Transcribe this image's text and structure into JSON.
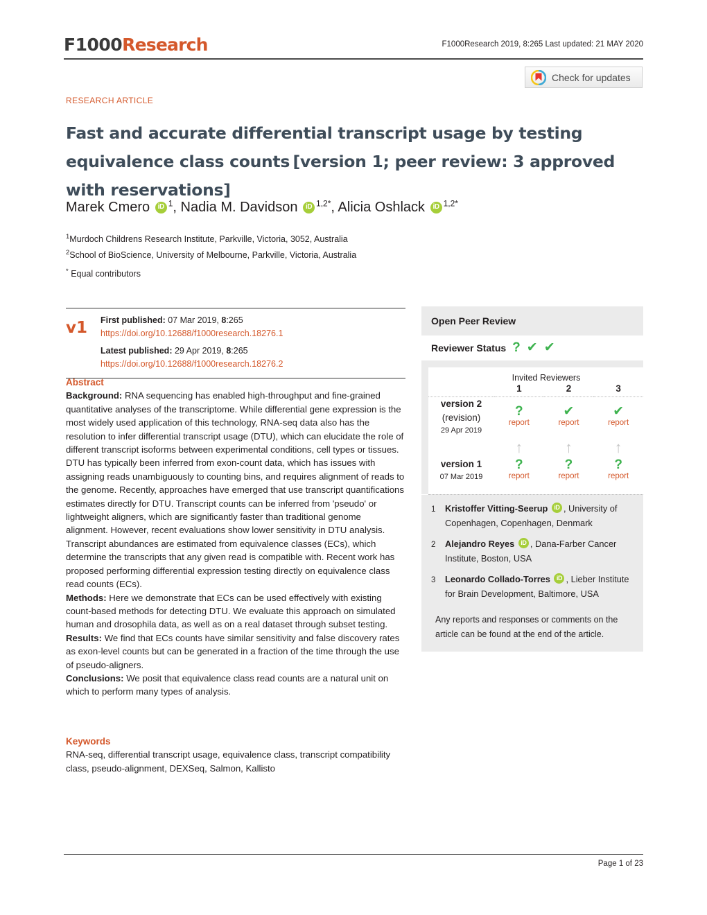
{
  "header": {
    "logo_f1000": "F1000",
    "logo_research": "Research",
    "running_head": "F1000Research 2019, 8:265 Last updated: 21 MAY 2020",
    "crossmark_label": "Check for updates",
    "crossmark_icon": "crossmark-icon"
  },
  "article": {
    "type": "RESEARCH ARTICLE",
    "title_main": "Fast and accurate differential transcript usage by testing equivalence class counts",
    "title_bracket": "[version 1; peer review: 3 approved with reservations]",
    "authors": [
      {
        "name": "Marek Cmero",
        "orcid": true,
        "sup": "1",
        "sep": ", "
      },
      {
        "name": "Nadia M. Davidson",
        "orcid": true,
        "sup": "1,2*",
        "sep": ", "
      },
      {
        "name": "Alicia Oshlack",
        "orcid": true,
        "sup": "1,2*",
        "sep": ""
      }
    ],
    "affiliations": [
      {
        "sup": "1",
        "text": "Murdoch Childrens Research Institute, Parkville, Victoria, 3052, Australia"
      },
      {
        "sup": "2",
        "text": "School of BioScience, University of Melbourne, Parkville, Victoria, Australia"
      }
    ],
    "equal_contrib_sup": "*",
    "equal_contrib": "Equal contributors"
  },
  "version_box": {
    "badge": "v1",
    "first_published_label": "First published:",
    "first_published_value": "07 Mar 2019, ",
    "first_published_vol": "8",
    "first_published_page": ":265",
    "first_doi": "https://doi.org/10.12688/f1000research.18276.1",
    "latest_published_label": "Latest published:",
    "latest_published_value": "29 Apr 2019, ",
    "latest_published_vol": "8",
    "latest_published_page": ":265",
    "latest_doi": "https://doi.org/10.12688/f1000research.18276.2"
  },
  "abstract": {
    "heading": "Abstract",
    "background_label": "Background:",
    "background_text": " RNA sequencing has enabled high-throughput and fine-grained quantitative analyses of the transcriptome. While differential gene expression is the most widely used application of this technology, RNA-seq data also has the resolution to infer differential transcript usage (DTU), which can elucidate the role of different transcript isoforms between experimental conditions, cell types or tissues. DTU has typically been inferred from exon-count data, which has issues with assigning reads unambiguously to counting bins, and requires alignment of reads to the genome. Recently, approaches have emerged that use transcript quantifications estimates directly for DTU. Transcript counts can be inferred from 'pseudo' or lightweight aligners, which are significantly faster than traditional genome alignment. However, recent evaluations show lower sensitivity in DTU analysis. Transcript abundances are estimated from equivalence classes (ECs), which determine the transcripts that any given read is compatible with. Recent work has proposed performing differential expression testing directly on equivalence class read counts (ECs).",
    "methods_label": "Methods:",
    "methods_text": " Here we demonstrate that ECs can be used effectively with existing count-based methods for detecting DTU. We evaluate this approach on simulated human and drosophila data, as well as on a real dataset through subset testing.",
    "results_label": "Results:",
    "results_text": " We find that ECs counts have similar sensitivity and false discovery rates as exon-level counts but can be generated in a fraction of the time through the use of pseudo-aligners.",
    "conclusions_label": "Conclusions:",
    "conclusions_text": " We posit that equivalence class read counts are a natural unit on which to perform many types of analysis."
  },
  "keywords": {
    "heading": "Keywords",
    "text": "RNA-seq, differential transcript usage, equivalence class, transcript compatibility class, pseudo-alignment, DEXSeq, Salmon, Kallisto"
  },
  "peer_review": {
    "panel_title": "Open Peer Review",
    "status_label": "Reviewer Status",
    "status_icons": [
      "question",
      "check",
      "check"
    ],
    "invited_heading": "Invited Reviewers",
    "columns": [
      "1",
      "2",
      "3"
    ],
    "rows": [
      {
        "name": "version 2",
        "revision": "(revision)",
        "date": "29 Apr 2019",
        "marks": [
          "question",
          "check",
          "check"
        ],
        "reports": [
          "report",
          "report",
          "report"
        ]
      },
      {
        "name": "version 1",
        "revision": "",
        "date": "07 Mar 2019",
        "marks": [
          "question",
          "question",
          "question"
        ],
        "reports": [
          "report",
          "report",
          "report"
        ]
      }
    ],
    "arrows": [
      "up-arrow-icon",
      "up-arrow-icon",
      "up-arrow-icon"
    ],
    "reviewers": [
      {
        "num": "1",
        "name": "Kristoffer Vitting-Seerup",
        "orcid": true,
        "affil": ", University of Copenhagen, Copenhagen, Denmark"
      },
      {
        "num": "2",
        "name": "Alejandro Reyes",
        "orcid": true,
        "affil": ", Dana-Farber Cancer Institute, Boston, USA"
      },
      {
        "num": "3",
        "name": "Leonardo Collado-Torres",
        "orcid": true,
        "affil": ", Lieber Institute for Brain Development, Baltimore, USA"
      }
    ],
    "note": "Any reports and responses or comments on the article can be found at the end of the article."
  },
  "footer": {
    "page": "Page 1 of 23"
  },
  "colors": {
    "accent_orange": "#d4582b",
    "title_slate": "#3e4c59",
    "approved_green": "#3eb34f",
    "panel_gray": "#ebebeb",
    "orcid_green": "#a6ce39"
  }
}
